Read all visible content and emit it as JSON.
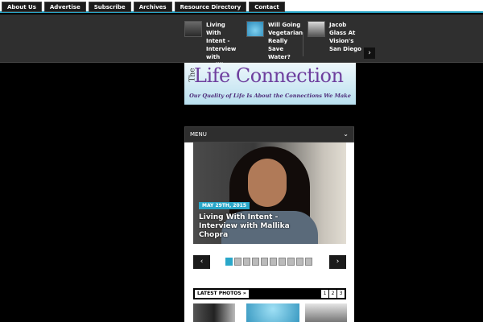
{
  "top_nav": {
    "items": [
      "About Us",
      "Advertise",
      "Subscribe",
      "Archives",
      "Resource Directory",
      "Contact"
    ]
  },
  "ticker": {
    "items": [
      {
        "title": "Living With Intent - Interview with Mallika Chopra"
      },
      {
        "title": "Will Going Vegetarian Really Save Water?"
      },
      {
        "title": "Jacob Glass At Vision's San Diego"
      }
    ],
    "next_label": "›"
  },
  "logo": {
    "the": "The",
    "life": "Life",
    "connection": "Connection",
    "tagline": "Our Quality of Life Is About the Connections We Make"
  },
  "menu": {
    "label": "MENU",
    "chevron": "⌄"
  },
  "slider": {
    "date": "MAY 29TH, 2015",
    "caption": "Living With Intent - Interview with Mallika Chopra",
    "prev_label": "‹",
    "next_label": "›",
    "dots_count": 10,
    "active_dot": 1
  },
  "latest_photos": {
    "label": "LATEST PHOTOS",
    "arrow": "»",
    "pages": [
      "1",
      "2",
      "3"
    ]
  },
  "colors": {
    "accent": "#2aa7c9",
    "purple": "#6e3f9e"
  }
}
